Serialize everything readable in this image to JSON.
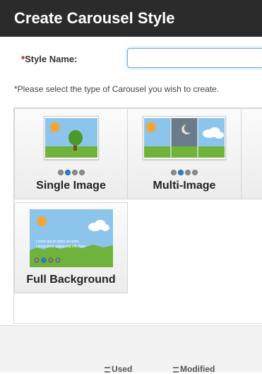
{
  "dialog": {
    "title": "Create Carousel Style"
  },
  "form": {
    "required_marker": "*",
    "style_name_label": "Style Name:",
    "style_name_value": "",
    "instruction": "*Please select the type of Carousel you wish to create."
  },
  "carousel_types": [
    {
      "label": "Single Image",
      "dots": 4,
      "active_dot": 2
    },
    {
      "label": "Multi-Image",
      "dots": 4,
      "active_dot": 2
    },
    {
      "label": "Full Background",
      "dots": 4,
      "active_dot": 2,
      "preview_text": "Lorem ipsum dolor sit amet, consectetur adipiscing elit. Nam"
    }
  ],
  "background_columns": [
    "Used",
    "Modified"
  ],
  "colors": {
    "header_bg": "#2b2b2b",
    "sky": "#7fb7e6",
    "grass": "#6fb33c",
    "sun": "#f4a633",
    "active_dot": "#2f7fd3"
  }
}
